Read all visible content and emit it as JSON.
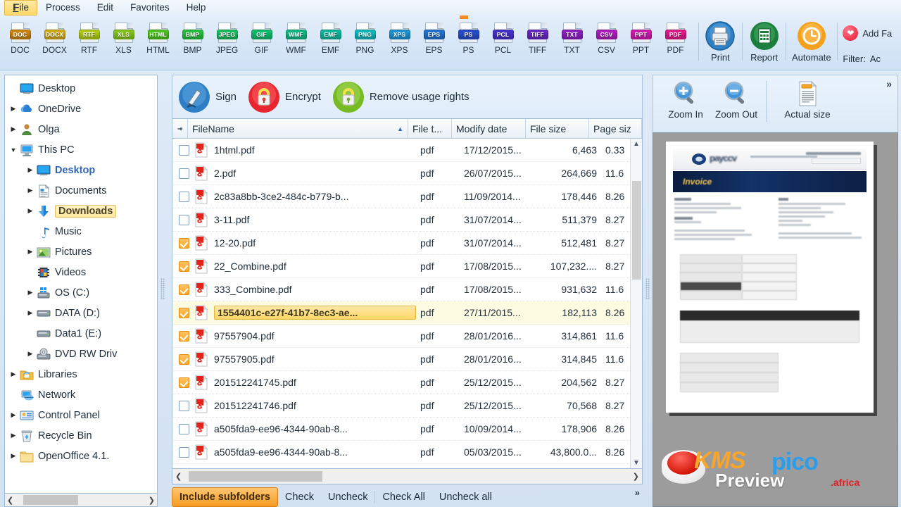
{
  "menu": {
    "items": [
      {
        "label": "File",
        "accel": "F",
        "active": true
      },
      {
        "label": "Process",
        "accel": "P",
        "active": false
      },
      {
        "label": "Edit",
        "accel": "E",
        "active": false
      },
      {
        "label": "Favorites",
        "accel": "F",
        "active": false
      },
      {
        "label": "Help",
        "accel": "H",
        "active": false
      }
    ]
  },
  "toolbar": {
    "formats": [
      {
        "label": "DOC",
        "tag": "DOC",
        "color": "#d3890f"
      },
      {
        "label": "DOCX",
        "tag": "DOCX",
        "color": "#d8b016"
      },
      {
        "label": "RTF",
        "tag": "RTF",
        "color": "#b6d118"
      },
      {
        "label": "XLS",
        "tag": "XLS",
        "color": "#87cc1b"
      },
      {
        "label": "HTML",
        "tag": "HTML",
        "color": "#4ec91f"
      },
      {
        "label": "BMP",
        "tag": "BMP",
        "color": "#25c63f"
      },
      {
        "label": "JPEG",
        "tag": "JPEG",
        "color": "#18c460"
      },
      {
        "label": "GIF",
        "tag": "GIF",
        "color": "#11c271"
      },
      {
        "label": "WMF",
        "tag": "WMF",
        "color": "#0fbf86"
      },
      {
        "label": "EMF",
        "tag": "EMF",
        "color": "#0fbda2"
      },
      {
        "label": "PNG",
        "tag": "PNG",
        "color": "#12bcc3"
      },
      {
        "label": "XPS",
        "tag": "XPS",
        "color": "#2098d9"
      },
      {
        "label": "EPS",
        "tag": "EPS",
        "color": "#2277d6"
      },
      {
        "label": "PS",
        "tag": "PS",
        "color": "#2a4fd4"
      },
      {
        "label": "PCL",
        "tag": "PCL",
        "color": "#4733cf"
      },
      {
        "label": "TIFF",
        "tag": "TIFF",
        "color": "#6a28cb"
      },
      {
        "label": "TXT",
        "tag": "TXT",
        "color": "#9020c7"
      },
      {
        "label": "CSV",
        "tag": "CSV",
        "color": "#b31ec4"
      },
      {
        "label": "PPT",
        "tag": "PPT",
        "color": "#d41cb6"
      },
      {
        "label": "PDF",
        "tag": "PDF",
        "color": "#e81a8e"
      }
    ],
    "print_label": "Print",
    "report_label": "Report",
    "automate_label": "Automate",
    "add_favorites_label": "Add Fa",
    "filter_label": "Filter:",
    "filter_value": "Ac",
    "marked_format": "PS"
  },
  "tree": {
    "nodes": [
      {
        "label": "Desktop",
        "icon": "monitor-icon",
        "expander": "none",
        "indent": 0,
        "selected": false,
        "blue": false
      },
      {
        "label": "OneDrive",
        "icon": "cloud-icon",
        "expander": "closed",
        "indent": 0,
        "selected": false,
        "blue": false
      },
      {
        "label": "Olga",
        "icon": "user-icon",
        "expander": "closed",
        "indent": 0,
        "selected": false,
        "blue": false
      },
      {
        "label": "This PC",
        "icon": "pc-icon",
        "expander": "open",
        "indent": 0,
        "selected": false,
        "blue": false
      },
      {
        "label": "Desktop",
        "icon": "monitor-icon",
        "expander": "closed",
        "indent": 1,
        "selected": false,
        "blue": true
      },
      {
        "label": "Documents",
        "icon": "document-icon",
        "expander": "closed",
        "indent": 1,
        "selected": false,
        "blue": false
      },
      {
        "label": "Downloads",
        "icon": "download-arrow-icon",
        "expander": "closed",
        "indent": 1,
        "selected": true,
        "blue": false
      },
      {
        "label": "Music",
        "icon": "music-note-icon",
        "expander": "none",
        "indent": 1,
        "selected": false,
        "blue": false
      },
      {
        "label": "Pictures",
        "icon": "picture-icon",
        "expander": "closed",
        "indent": 1,
        "selected": false,
        "blue": false
      },
      {
        "label": "Videos",
        "icon": "video-icon",
        "expander": "none",
        "indent": 1,
        "selected": false,
        "blue": false
      },
      {
        "label": "OS (C:)",
        "icon": "windows-drive-icon",
        "expander": "closed",
        "indent": 1,
        "selected": false,
        "blue": false
      },
      {
        "label": "DATA (D:)",
        "icon": "drive-icon",
        "expander": "closed",
        "indent": 1,
        "selected": false,
        "blue": false
      },
      {
        "label": "Data1 (E:)",
        "icon": "drive-icon",
        "expander": "none",
        "indent": 1,
        "selected": false,
        "blue": false
      },
      {
        "label": "DVD RW Driv",
        "icon": "dvd-drive-icon",
        "expander": "closed",
        "indent": 1,
        "selected": false,
        "blue": false
      },
      {
        "label": "Libraries",
        "icon": "library-folder-icon",
        "expander": "closed",
        "indent": 0,
        "selected": false,
        "blue": false
      },
      {
        "label": "Network",
        "icon": "network-icon",
        "expander": "none",
        "indent": 0,
        "selected": false,
        "blue": false
      },
      {
        "label": "Control Panel",
        "icon": "control-panel-icon",
        "expander": "closed",
        "indent": 0,
        "selected": false,
        "blue": false
      },
      {
        "label": "Recycle Bin",
        "icon": "recycle-bin-icon",
        "expander": "closed",
        "indent": 0,
        "selected": false,
        "blue": false
      },
      {
        "label": "OpenOffice 4.1.",
        "icon": "folder-icon",
        "expander": "closed",
        "indent": 0,
        "selected": false,
        "blue": false
      }
    ]
  },
  "sign_bar": {
    "sign_label": "Sign",
    "encrypt_label": "Encrypt",
    "remove_rights_label": "Remove usage rights"
  },
  "grid": {
    "columns": [
      {
        "label": "FileName",
        "sorted": "asc"
      },
      {
        "label": "File t..."
      },
      {
        "label": "Modify date"
      },
      {
        "label": "File size"
      },
      {
        "label": "Page siz"
      }
    ],
    "rows": [
      {
        "checked": false,
        "selected": false,
        "name": "1html.pdf",
        "type": "pdf",
        "date": "17/12/2015...",
        "size": "6,463",
        "page": "0.33"
      },
      {
        "checked": false,
        "selected": false,
        "name": "2.pdf",
        "type": "pdf",
        "date": "26/07/2015...",
        "size": "264,669",
        "page": "11.6"
      },
      {
        "checked": false,
        "selected": false,
        "name": "2c83a8bb-3ce2-484c-b779-b...",
        "type": "pdf",
        "date": "11/09/2014...",
        "size": "178,446",
        "page": "8.26"
      },
      {
        "checked": false,
        "selected": false,
        "name": "3-11.pdf",
        "type": "pdf",
        "date": "31/07/2014...",
        "size": "511,379",
        "page": "8.27"
      },
      {
        "checked": true,
        "selected": false,
        "name": "12-20.pdf",
        "type": "pdf",
        "date": "31/07/2014...",
        "size": "512,481",
        "page": "8.27"
      },
      {
        "checked": true,
        "selected": false,
        "name": "22_Combine.pdf",
        "type": "pdf",
        "date": "17/08/2015...",
        "size": "107,232....",
        "page": "8.27"
      },
      {
        "checked": true,
        "selected": false,
        "name": "333_Combine.pdf",
        "type": "pdf",
        "date": "17/08/2015...",
        "size": "931,632",
        "page": "11.6"
      },
      {
        "checked": true,
        "selected": true,
        "name": "1554401c-e27f-41b7-8ec3-ae...",
        "type": "pdf",
        "date": "27/11/2015...",
        "size": "182,113",
        "page": "8.26"
      },
      {
        "checked": true,
        "selected": false,
        "name": "97557904.pdf",
        "type": "pdf",
        "date": "28/01/2016...",
        "size": "314,861",
        "page": "11.6"
      },
      {
        "checked": true,
        "selected": false,
        "name": "97557905.pdf",
        "type": "pdf",
        "date": "28/01/2016...",
        "size": "314,845",
        "page": "11.6"
      },
      {
        "checked": true,
        "selected": false,
        "name": "201512241745.pdf",
        "type": "pdf",
        "date": "25/12/2015...",
        "size": "204,562",
        "page": "8.27"
      },
      {
        "checked": false,
        "selected": false,
        "name": "201512241746.pdf",
        "type": "pdf",
        "date": "25/12/2015...",
        "size": "70,568",
        "page": "8.27"
      },
      {
        "checked": false,
        "selected": false,
        "name": "a505fda9-ee96-4344-90ab-8...",
        "type": "pdf",
        "date": "10/09/2014...",
        "size": "178,906",
        "page": "8.26"
      },
      {
        "checked": false,
        "selected": false,
        "name": "a505fda9-ee96-4344-90ab-8...",
        "type": "pdf",
        "date": "05/03/2015...",
        "size": "43,800.0...",
        "page": "8.26"
      }
    ]
  },
  "bottom": {
    "include_subfolders": "Include subfolders",
    "check": "Check",
    "uncheck": "Uncheck",
    "check_all": "Check All",
    "uncheck_all": "Uncheck all",
    "chevron": "»"
  },
  "preview": {
    "zoom_in": "Zoom In",
    "zoom_out": "Zoom Out",
    "actual_size": "Actual size",
    "chevron": "»",
    "document_title": "Invoice",
    "watermark": {
      "kms": "KMS",
      "pico": "pico",
      "tld": ".africa",
      "preview": "Preview"
    }
  }
}
